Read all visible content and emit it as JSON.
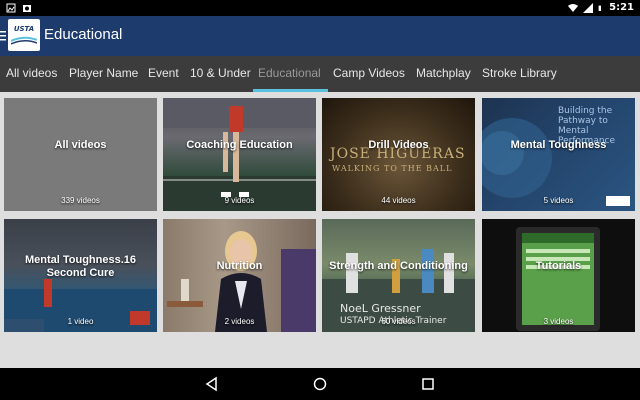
{
  "status_bar": {
    "time": "5:21",
    "icons": [
      "image-icon",
      "photo-icon",
      "wifi-icon",
      "signal-icon",
      "battery-icon"
    ]
  },
  "app_bar": {
    "logo_text": "USTA",
    "title": "Educational",
    "menu_icon": "menu-icon"
  },
  "tabs": [
    {
      "label": "All videos"
    },
    {
      "label": "Player Name"
    },
    {
      "label": "Event"
    },
    {
      "label": "10 & Under"
    },
    {
      "label": "Educational",
      "active": true
    },
    {
      "label": "Camp Videos"
    },
    {
      "label": "Matchplay"
    },
    {
      "label": "Stroke Library"
    }
  ],
  "tiles": [
    {
      "title": "All videos",
      "count": "339 videos"
    },
    {
      "title": "Coaching Education",
      "count": "9 videos"
    },
    {
      "title": "Drill Videos",
      "count": "44 videos",
      "overlay_line1": "JOSE HIGUERAS",
      "overlay_line2": "WALKING TO THE BALL"
    },
    {
      "title": "Mental Toughness",
      "count": "5 videos",
      "overlay_text": "Building the Pathway to Mental Performance"
    },
    {
      "title": "Mental Toughness.16 Second Cure",
      "count": "1 video"
    },
    {
      "title": "Nutrition",
      "count": "2 videos"
    },
    {
      "title": "Strength and Conditioning",
      "count": "60 videos",
      "overlay_name": "NoeL Gressner",
      "overlay_role": "USTAPD Athletic Trainer"
    },
    {
      "title": "Tutorials",
      "count": "3 videos"
    }
  ],
  "nav_bar": {
    "icons": [
      "back-icon",
      "home-icon",
      "recents-icon"
    ]
  }
}
